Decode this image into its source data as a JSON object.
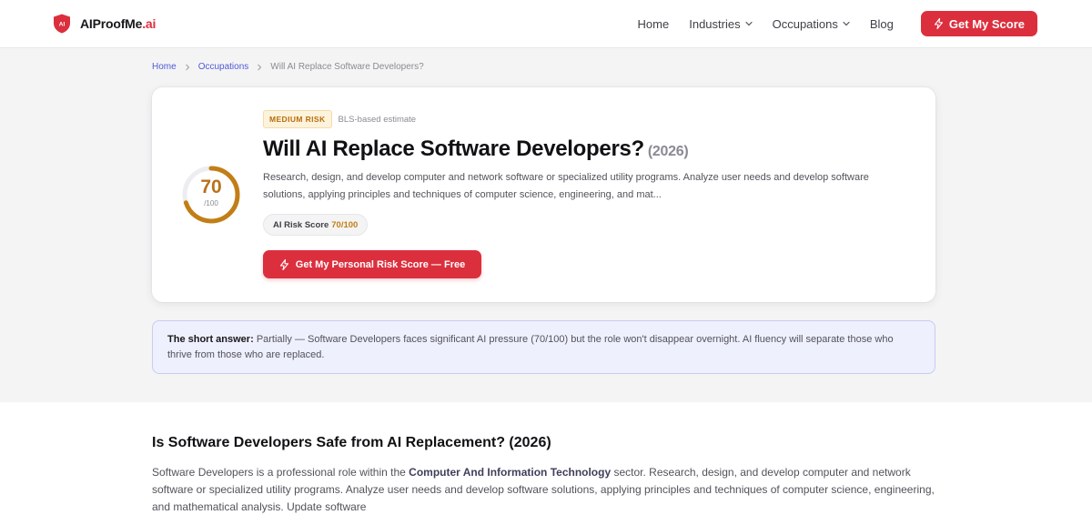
{
  "brand": {
    "name_main": "AIProofMe",
    "name_suffix": ".ai",
    "mark": "AI",
    "accent": "#dc2f3d"
  },
  "nav": {
    "home": "Home",
    "industries": "Industries",
    "occupations": "Occupations",
    "blog": "Blog",
    "cta": "Get My Score"
  },
  "breadcrumb": {
    "home": "Home",
    "occupations": "Occupations",
    "current": "Will AI Replace Software Developers?"
  },
  "hero": {
    "risk_badge": "MEDIUM RISK",
    "risk_note": "BLS-based estimate",
    "title": "Will AI Replace Software Developers?",
    "year": "(2026)",
    "description": "Research, design, and develop computer and network software or specialized utility programs. Analyze user needs and develop software solutions, applying principles and techniques of computer science, engineering, and mat...",
    "score_label": "AI Risk Score",
    "score_value": "70/100",
    "gauge_score": "70",
    "gauge_max": "/100",
    "gauge_fraction": 0.7,
    "gauge_color": "#c27e16",
    "cta": "Get My Personal Risk Score — Free"
  },
  "short_answer": {
    "label": "The short answer:",
    "text": "Partially — Software Developers faces significant AI pressure (70/100) but the role won't disappear overnight. AI fluency will separate those who thrive from those who are replaced."
  },
  "article": {
    "heading": "Is Software Developers Safe from AI Replacement? (2026)",
    "intro_prefix": "Software Developers is a professional role within the",
    "sector": "Computer And Information Technology",
    "intro_suffix": "sector. Research, design, and develop computer and network software or specialized utility programs. Analyze user needs and develop software solutions, applying principles and techniques of computer science, engineering, and mathematical analysis. Update software"
  }
}
